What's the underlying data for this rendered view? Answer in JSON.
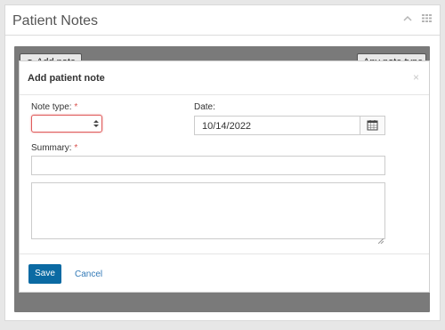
{
  "panel": {
    "title": "Patient Notes",
    "toolbar": {
      "add_note_label": "Add note",
      "filter_value": "Any note type"
    }
  },
  "modal": {
    "title": "Add patient note",
    "close_glyph": "×",
    "note_type": {
      "label": "Note type:",
      "required_marker": "*",
      "value": ""
    },
    "date": {
      "label": "Date:",
      "value": "10/14/2022"
    },
    "summary": {
      "label": "Summary:",
      "required_marker": "*",
      "value": ""
    },
    "details": {
      "value": ""
    },
    "buttons": {
      "save": "Save",
      "cancel": "Cancel"
    }
  },
  "colors": {
    "primary": "#0b6aa3",
    "link": "#337ab7",
    "error": "#d9534f",
    "overlay": "#7a7a7a"
  },
  "icons": {
    "collapse": "chevron-up-icon",
    "menu": "grid-icon",
    "add": "plus-circle-icon",
    "calendar": "calendar-icon",
    "close": "close-icon"
  }
}
